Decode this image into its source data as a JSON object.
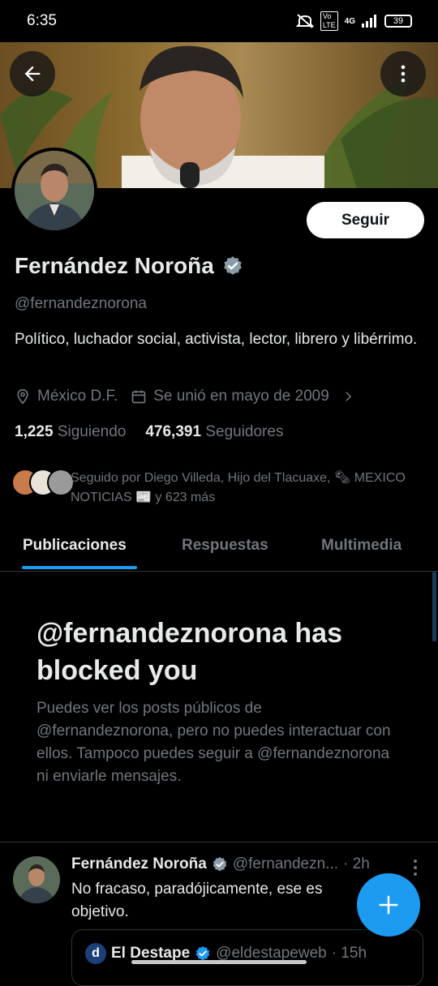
{
  "status": {
    "time": "6:35",
    "network": "4G",
    "battery": "39"
  },
  "profile": {
    "name": "Fernández Noroña",
    "handle": "@fernandeznorona",
    "bio": "Político, luchador social, activista, lector, librero y libérrimo.",
    "location": "México D.F.",
    "joined": "Se unió en mayo de 2009",
    "following_count": "1,225",
    "following_label": "Siguiendo",
    "followers_count": "476,391",
    "followers_label": "Seguidores",
    "followed_by": "Seguido por Diego Villeda, Hijo del Tlacuaxe, 🗞 MEXICO NOTICIAS 📰 y 623 más",
    "verified_color": "#1d9bf0"
  },
  "buttons": {
    "follow": "Seguir"
  },
  "tabs": [
    {
      "label": "Publicaciones",
      "active": true
    },
    {
      "label": "Respuestas",
      "active": false
    },
    {
      "label": "Multimedia",
      "active": false
    }
  ],
  "blocked": {
    "title": "@fernandeznorona has blocked you",
    "description": "Puedes ver los posts públicos de @fernandeznorona, pero no puedes interactuar con ellos. Tampoco puedes seguir a @fernandeznorona ni enviarle mensajes."
  },
  "tweet": {
    "name": "Fernández Noroña",
    "handle": "@fernandezn...",
    "time": "· 2h",
    "text": "No fracaso, paradójicamente, ese es objetivo.",
    "quote": {
      "name": "El Destape",
      "handle": "@eldestapeweb",
      "time": "· 15h"
    }
  },
  "icons": {
    "back": "arrow-left-icon",
    "more": "more-vertical-icon",
    "verified": "verified-badge-icon",
    "location": "location-pin-icon",
    "calendar": "calendar-icon",
    "chevron": "chevron-right-icon",
    "compose": "plus-icon"
  }
}
